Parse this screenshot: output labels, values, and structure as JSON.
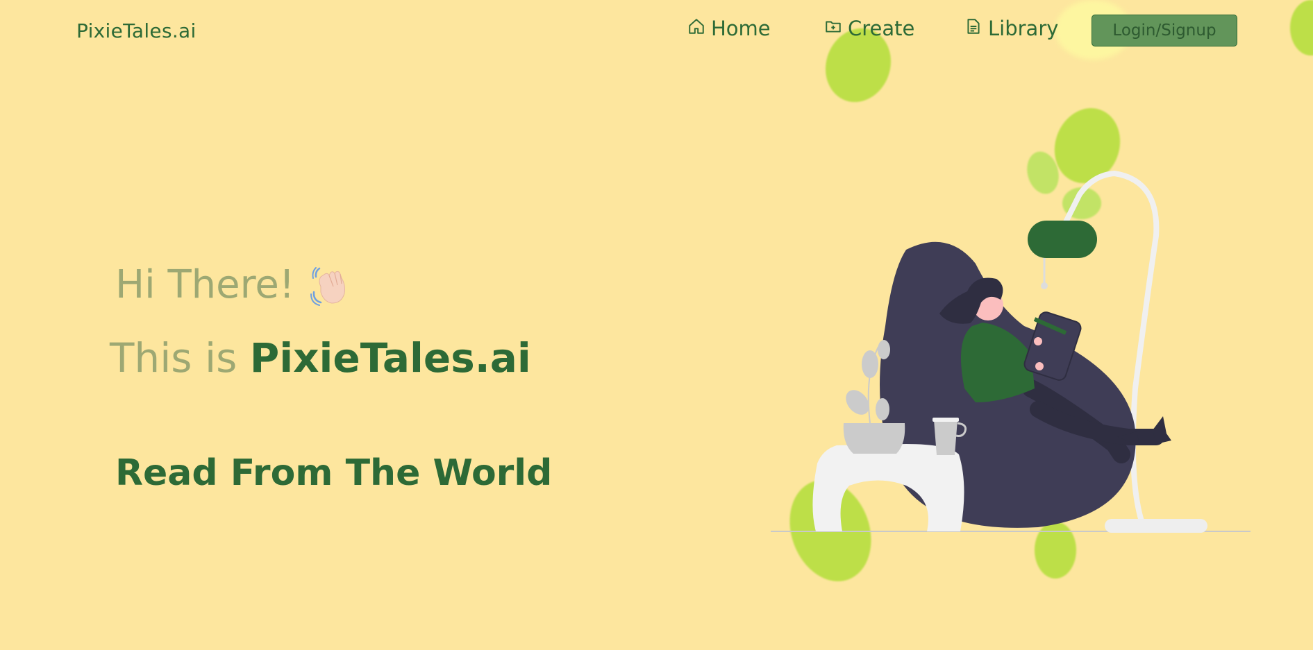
{
  "brand": {
    "name": "PixieTales.ai"
  },
  "nav": {
    "items": [
      {
        "label": "Home",
        "icon": "home-icon"
      },
      {
        "label": "Create",
        "icon": "folder-plus-icon"
      },
      {
        "label": "Library",
        "icon": "document-icon"
      }
    ],
    "login_label": "Login/Signup"
  },
  "hero": {
    "greeting": "Hi There!",
    "greeting_emoji": "waving-hand-icon",
    "title_prefix": "This is",
    "title_brand": "PixieTales.ai",
    "tagline": "Read From The World"
  },
  "colors": {
    "background": "#fde69e",
    "primary": "#2d6a36",
    "muted": "#9da873",
    "button_bg": "#62955a",
    "blob": "#b8dd44"
  }
}
